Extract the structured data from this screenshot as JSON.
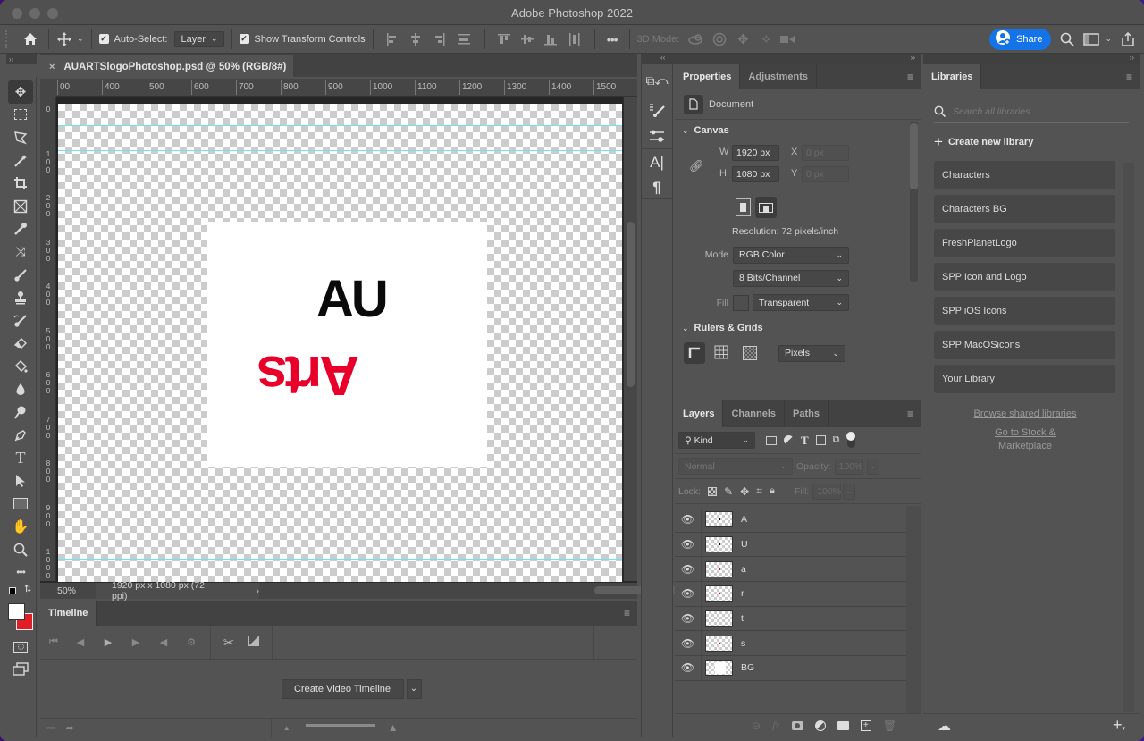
{
  "window": {
    "title": "Adobe Photoshop 2022"
  },
  "options_bar": {
    "auto_select_label": "Auto-Select:",
    "auto_select_checked": true,
    "auto_select_value": "Layer",
    "show_transform_label": "Show Transform Controls",
    "show_transform_checked": true,
    "three_d_mode_label": "3D Mode:",
    "share_label": "Share"
  },
  "document": {
    "tab_title": "AUARTSlogoPhotoshop.psd @ 50% (RGB/8#)",
    "zoom": "50%",
    "doc_info": "1920 px x 1080 px (72 ppi)",
    "logo_top": "AU",
    "logo_bottom": "Arts",
    "logo_colors": {
      "top": "#0a0a0a",
      "bottom": "#e8002a"
    },
    "guide_color": "#6fe3ee",
    "hruler_labels": [
      "00",
      "400",
      "500",
      "600",
      "700",
      "800",
      "900",
      "1000",
      "1100",
      "1200",
      "1300",
      "1400",
      "1500"
    ],
    "vruler_labels": [
      "0",
      "100",
      "200",
      "300",
      "400",
      "500",
      "600",
      "700",
      "800",
      "900",
      "1000"
    ]
  },
  "tools": [
    "move-tool",
    "rectangular-marquee-tool",
    "lasso-tool",
    "magic-wand-tool",
    "crop-tool",
    "frame-tool",
    "eyedropper-tool",
    "spot-healing-tool",
    "brush-tool",
    "clone-stamp-tool",
    "history-brush-tool",
    "eraser-tool",
    "paint-bucket-tool",
    "blur-tool",
    "dodge-tool",
    "pen-tool",
    "type-tool",
    "path-selection-tool",
    "rectangle-tool",
    "hand-tool",
    "zoom-tool",
    "edit-toolbar"
  ],
  "colors": {
    "foreground": "#ffffff",
    "background": "#e01e25",
    "accent": "#1473e6"
  },
  "timeline": {
    "tab_label": "Timeline",
    "create_button_label": "Create Video Timeline"
  },
  "properties": {
    "tabs": [
      "Properties",
      "Adjustments"
    ],
    "doc_label": "Document",
    "canvas_section": "Canvas",
    "w_label": "W",
    "w_value": "1920 px",
    "h_label": "H",
    "h_value": "1080 px",
    "x_label": "X",
    "x_placeholder": "0 px",
    "y_label": "Y",
    "y_placeholder": "0 px",
    "resolution": "Resolution: 72 pixels/inch",
    "mode_label": "Mode",
    "mode_value": "RGB Color",
    "bits_value": "8 Bits/Channel",
    "fill_label": "Fill",
    "fill_value": "Transparent",
    "rulers_section": "Rulers & Grids",
    "units_value": "Pixels"
  },
  "layers_panel": {
    "tabs": [
      "Layers",
      "Channels",
      "Paths"
    ],
    "filter_kind": "Kind",
    "blend_mode": "Normal",
    "opacity_label": "Opacity:",
    "opacity_value": "100%",
    "lock_label": "Lock:",
    "fill_label": "Fill:",
    "fill_value": "100%",
    "layers": [
      {
        "name": "A",
        "visible": true
      },
      {
        "name": "U",
        "visible": true
      },
      {
        "name": "a",
        "visible": true
      },
      {
        "name": "r",
        "visible": true
      },
      {
        "name": "t",
        "visible": true
      },
      {
        "name": "s",
        "visible": true
      },
      {
        "name": "BG",
        "visible": true
      }
    ]
  },
  "libraries": {
    "tab_label": "Libraries",
    "search_placeholder": "Search all libraries",
    "create_label": "Create new library",
    "items": [
      "Characters",
      "Characters BG",
      "FreshPlanetLogo",
      "SPP Icon and Logo",
      "SPP iOS Icons",
      "SPP MacOSicons",
      "Your Library"
    ],
    "browse_link": "Browse shared libraries",
    "stock_link_line1": "Go to Stock &",
    "stock_link_line2": "Marketplace"
  }
}
